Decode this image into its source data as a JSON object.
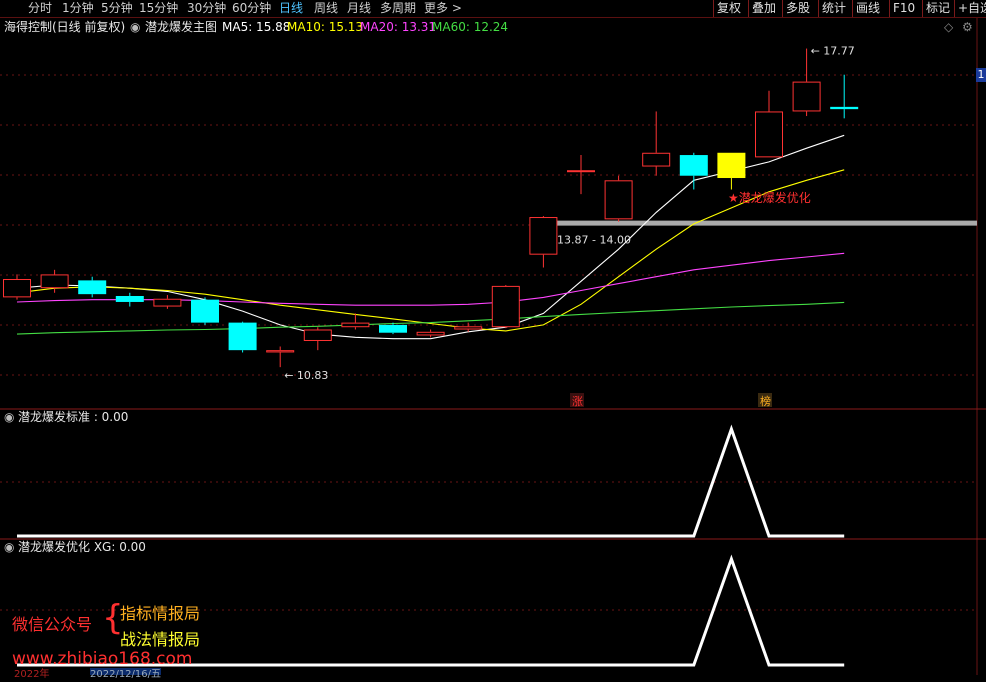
{
  "toolbar": {
    "periods": [
      "分时",
      "1分钟",
      "5分钟",
      "15分钟",
      "30分钟",
      "60分钟",
      "日线",
      "周线",
      "月线",
      "多周期",
      "更多 >"
    ],
    "active_period": "日线",
    "right_buttons": [
      "复权",
      "叠加",
      "多股",
      "统计",
      "画线",
      "F10",
      "标记",
      "+自选"
    ]
  },
  "main_panel": {
    "title": "海得控制(日线 前复权)",
    "indicator_name": "潜龙爆发主图",
    "ma": [
      {
        "label": "MA5: 15.88",
        "color": "#ffffff"
      },
      {
        "label": "MA10: 15.13",
        "color": "#ffff00"
      },
      {
        "label": "MA20: 13.31",
        "color": "#ff44ff"
      },
      {
        "label": "MA60: 12.24",
        "color": "#44dd44"
      }
    ],
    "high_label": "17.77",
    "low_label": "10.83",
    "zone_label": "13.87 - 14.00",
    "signal_label": "★潜龙爆发优化",
    "marker_zhang": "涨",
    "marker_bang": "榜",
    "right_badge": "1"
  },
  "sub_panel_1": {
    "title": "潜龙爆发标准 : 0.00"
  },
  "sub_panel_2": {
    "title": "潜龙爆发优化 XG: 0.00"
  },
  "watermark": {
    "wechat": "微信公众号",
    "brand1": "指标情报局",
    "brand2": "战法情报局",
    "url": "www.zhibiao168.com"
  },
  "date_axis": {
    "labels": [
      "2022年",
      "2022/12/16/五"
    ]
  },
  "colors": {
    "up": "#ff3333",
    "down": "#00ffff",
    "signal": "#ffff00",
    "grid": "#6a1515",
    "ma5": "#ffffff",
    "ma10": "#ffff00",
    "ma20": "#ff44ff",
    "ma60": "#44dd44"
  },
  "chart_data": {
    "type": "candlestick",
    "candles": [
      {
        "open": 12.35,
        "close": 12.75,
        "high": 12.85,
        "low": 12.3,
        "dir": "up"
      },
      {
        "open": 12.55,
        "close": 12.85,
        "high": 12.95,
        "low": 12.45,
        "dir": "up"
      },
      {
        "open": 12.72,
        "close": 12.42,
        "high": 12.8,
        "low": 12.35,
        "dir": "down"
      },
      {
        "open": 12.38,
        "close": 12.25,
        "high": 12.45,
        "low": 12.15,
        "dir": "down"
      },
      {
        "open": 12.15,
        "close": 12.32,
        "high": 12.4,
        "low": 12.1,
        "dir": "up"
      },
      {
        "open": 12.3,
        "close": 11.8,
        "high": 12.35,
        "low": 11.75,
        "dir": "down"
      },
      {
        "open": 11.8,
        "close": 11.2,
        "high": 11.82,
        "low": 11.15,
        "dir": "down"
      },
      {
        "open": 11.15,
        "close": 11.2,
        "high": 11.28,
        "low": 10.83,
        "dir": "up"
      },
      {
        "open": 11.4,
        "close": 11.65,
        "high": 11.7,
        "low": 11.2,
        "dir": "up"
      },
      {
        "open": 11.7,
        "close": 11.8,
        "high": 12.0,
        "low": 11.65,
        "dir": "up"
      },
      {
        "open": 11.75,
        "close": 11.58,
        "high": 11.8,
        "low": 11.55,
        "dir": "down"
      },
      {
        "open": 11.52,
        "close": 11.6,
        "high": 11.65,
        "low": 11.48,
        "dir": "up"
      },
      {
        "open": 11.72,
        "close": 11.65,
        "high": 11.8,
        "low": 11.6,
        "dir": "up"
      },
      {
        "open": 11.7,
        "close": 12.6,
        "high": 12.62,
        "low": 11.68,
        "dir": "up"
      },
      {
        "open": 13.28,
        "close": 14.1,
        "high": 14.12,
        "low": 13.0,
        "dir": "up"
      },
      {
        "open": 15.12,
        "close": 15.12,
        "high": 15.45,
        "low": 14.6,
        "dir": "up"
      },
      {
        "open": 14.05,
        "close": 14.9,
        "high": 15.0,
        "low": 14.0,
        "dir": "up"
      },
      {
        "open": 15.2,
        "close": 15.5,
        "high": 16.4,
        "low": 15.0,
        "dir": "up"
      },
      {
        "open": 15.45,
        "close": 15.0,
        "high": 15.5,
        "low": 14.7,
        "dir": "down"
      },
      {
        "open": 15.5,
        "close": 14.95,
        "high": 15.5,
        "low": 14.7,
        "dir": "signal"
      },
      {
        "open": 15.4,
        "close": 16.4,
        "high": 16.85,
        "low": 15.4,
        "dir": "up"
      },
      {
        "open": 16.4,
        "close": 17.05,
        "high": 17.77,
        "low": 16.3,
        "dir": "up"
      },
      {
        "open": 16.5,
        "close": 16.45,
        "high": 17.2,
        "low": 16.25,
        "dir": "down"
      }
    ],
    "ma5": [
      12.55,
      12.62,
      12.6,
      12.55,
      12.48,
      12.3,
      12.05,
      11.75,
      11.55,
      11.48,
      11.45,
      11.45,
      11.6,
      11.7,
      12.0,
      12.7,
      13.4,
      14.2,
      14.9,
      15.1,
      15.3,
      15.6,
      15.88
    ],
    "ma10": [
      12.45,
      12.55,
      12.58,
      12.55,
      12.5,
      12.42,
      12.3,
      12.18,
      12.08,
      11.98,
      11.88,
      11.78,
      11.68,
      11.62,
      11.75,
      12.2,
      12.8,
      13.4,
      13.95,
      14.3,
      14.65,
      14.9,
      15.13
    ],
    "ma20": [
      12.25,
      12.28,
      12.3,
      12.3,
      12.3,
      12.28,
      12.25,
      12.22,
      12.2,
      12.18,
      12.18,
      12.18,
      12.2,
      12.25,
      12.35,
      12.5,
      12.65,
      12.8,
      12.95,
      13.05,
      13.15,
      13.23,
      13.31
    ],
    "ma60": [
      11.55,
      11.58,
      11.6,
      11.62,
      11.64,
      11.65,
      11.67,
      11.7,
      11.72,
      11.75,
      11.78,
      11.8,
      11.84,
      11.88,
      11.93,
      11.98,
      12.02,
      12.06,
      12.1,
      12.14,
      12.17,
      12.2,
      12.24
    ],
    "zone": [
      13.87,
      14.0
    ],
    "ylim": [
      10.55,
      18.0
    ],
    "sub1_values": [
      0,
      0,
      0,
      0,
      0,
      0,
      0,
      0,
      0,
      0,
      0,
      0,
      0,
      0,
      0,
      0,
      0,
      0,
      0,
      1,
      0,
      0,
      0
    ],
    "sub2_values": [
      0,
      0,
      0,
      0,
      0,
      0,
      0,
      0,
      0,
      0,
      0,
      0,
      0,
      0,
      0,
      0,
      0,
      0,
      0,
      1,
      0,
      0,
      0
    ]
  }
}
